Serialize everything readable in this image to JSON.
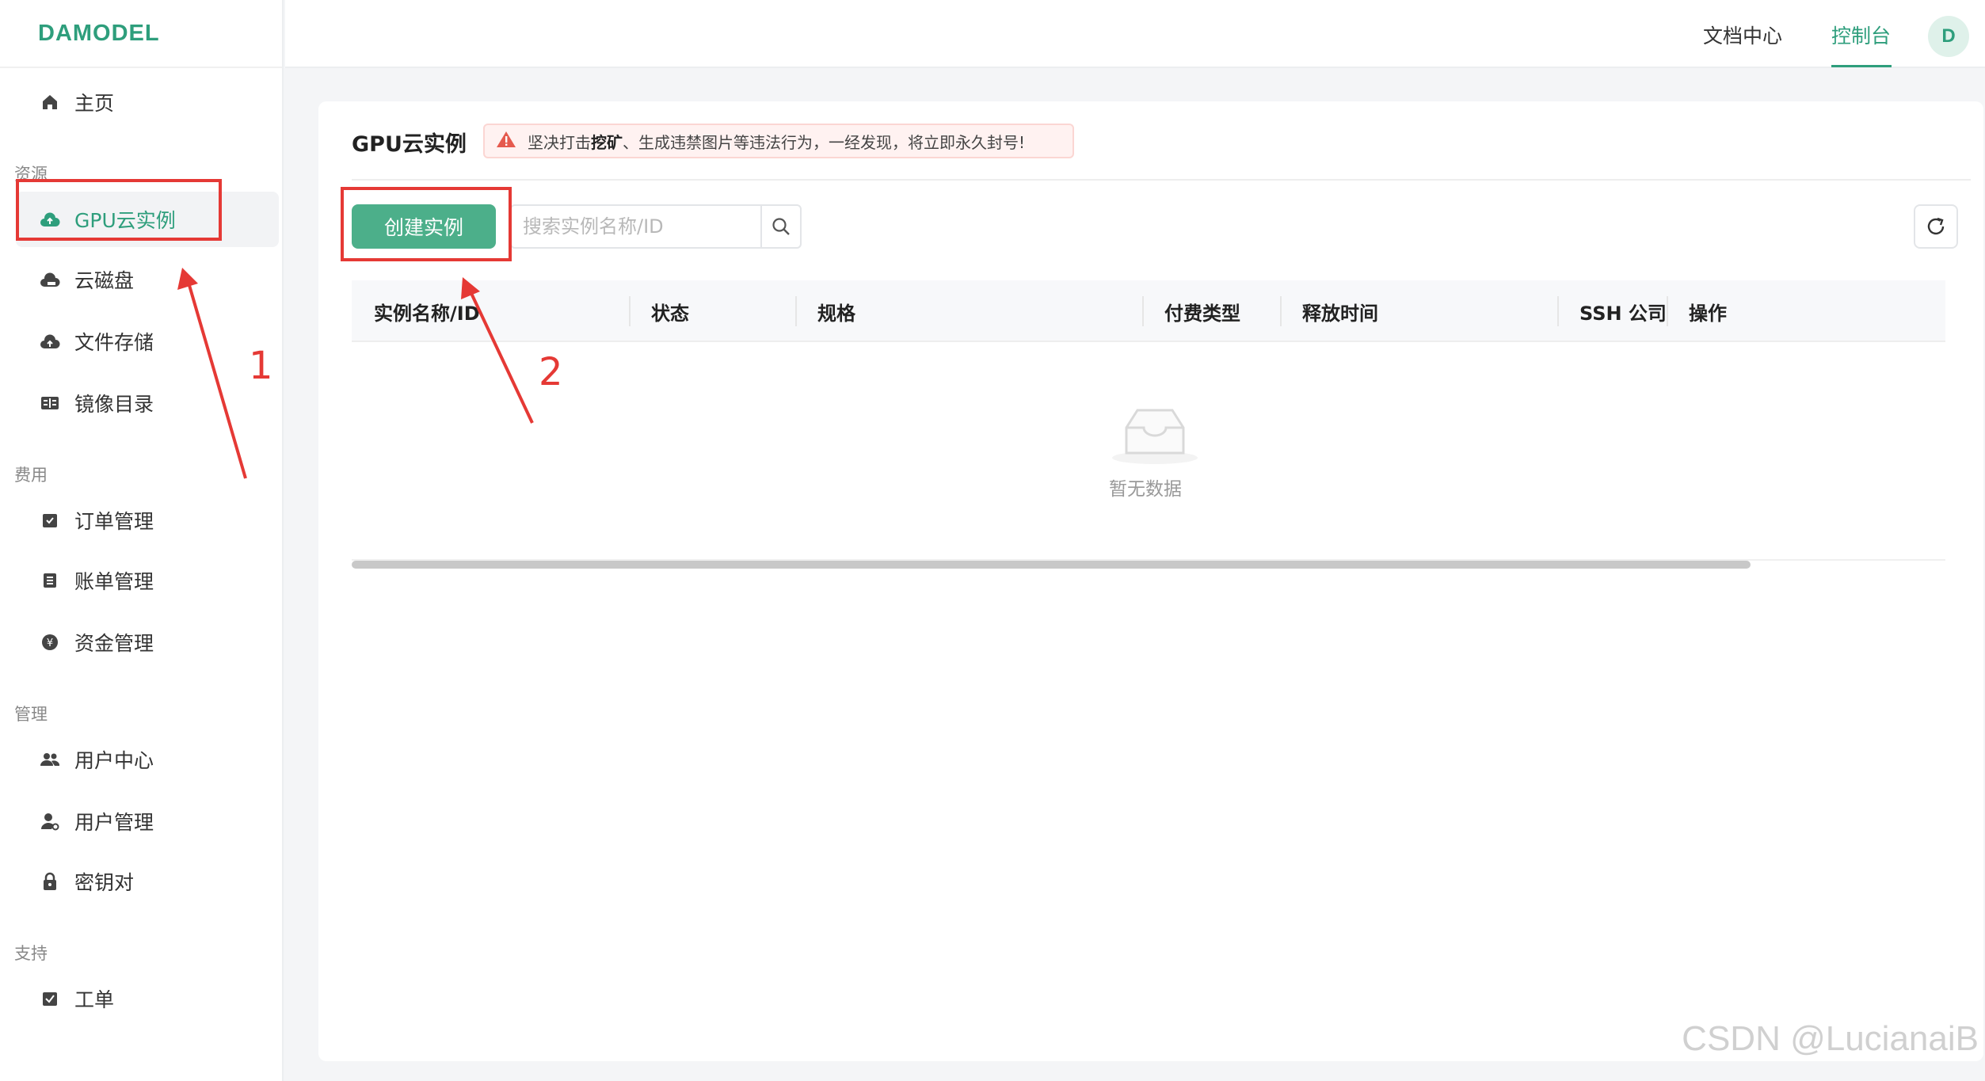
{
  "brand": {
    "logo": "DAMODEL",
    "color": "#2e9e7c"
  },
  "header": {
    "links": [
      {
        "label": "文档中心",
        "active": false
      },
      {
        "label": "控制台",
        "active": true
      }
    ],
    "avatar_initial": "D"
  },
  "sidebar": {
    "home": {
      "label": "主页",
      "icon": "home-icon"
    },
    "groups": [
      {
        "title": "资源",
        "items": [
          {
            "label": "GPU云实例",
            "icon": "cloud-gpu-icon",
            "active": true
          },
          {
            "label": "云磁盘",
            "icon": "cloud-disk-icon"
          },
          {
            "label": "文件存储",
            "icon": "cloud-upload-icon"
          },
          {
            "label": "镜像目录",
            "icon": "image-catalog-icon"
          }
        ]
      },
      {
        "title": "费用",
        "items": [
          {
            "label": "订单管理",
            "icon": "order-icon"
          },
          {
            "label": "账单管理",
            "icon": "bill-icon"
          },
          {
            "label": "资金管理",
            "icon": "yuan-icon"
          }
        ]
      },
      {
        "title": "管理",
        "items": [
          {
            "label": "用户中心",
            "icon": "users-icon"
          },
          {
            "label": "用户管理",
            "icon": "user-settings-icon"
          },
          {
            "label": "密钥对",
            "icon": "lock-icon"
          }
        ]
      },
      {
        "title": "支持",
        "items": [
          {
            "label": "工单",
            "icon": "ticket-icon"
          }
        ]
      }
    ]
  },
  "main": {
    "title": "GPU云实例",
    "warning": {
      "prefix": "坚决打击 ",
      "bold": "挖矿",
      "suffix": "、生成违禁图片等违法行为，一经发现，将立即永久封号!"
    },
    "create_button": "创建实例",
    "search_placeholder": "搜索实例名称/ID",
    "table": {
      "columns": [
        "实例名称/ID",
        "状态",
        "规格",
        "付费类型",
        "释放时间",
        "SSH 公司",
        "操作"
      ],
      "empty_text": "暂无数据"
    }
  },
  "annotations": {
    "marker_1": "1",
    "marker_2": "2"
  },
  "watermark": "CSDN @LucianaiB"
}
